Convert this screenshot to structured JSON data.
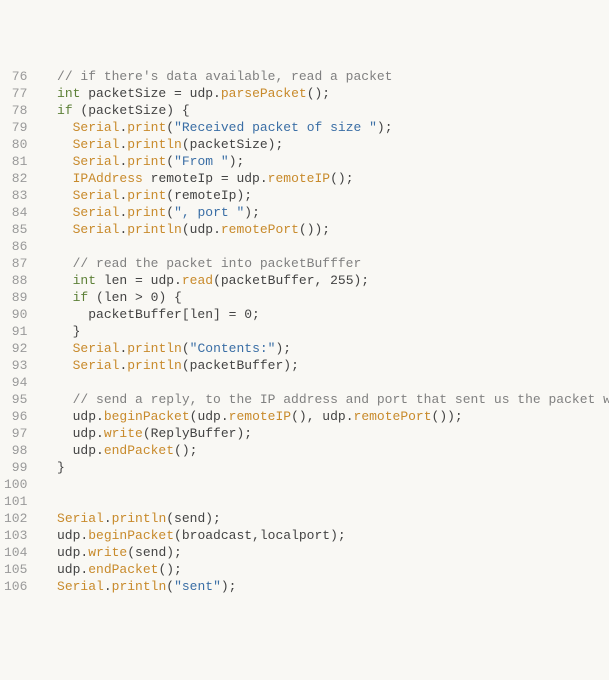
{
  "lines": [
    {
      "n": 76,
      "tokens": [
        {
          "t": "  ",
          "c": "pn"
        },
        {
          "t": "// if there's data available, read a packet",
          "c": "cm"
        }
      ]
    },
    {
      "n": 77,
      "tokens": [
        {
          "t": "  ",
          "c": "pn"
        },
        {
          "t": "int",
          "c": "ty"
        },
        {
          "t": " packetSize = udp.",
          "c": "id"
        },
        {
          "t": "parsePacket",
          "c": "fn"
        },
        {
          "t": "();",
          "c": "pn"
        }
      ]
    },
    {
      "n": 78,
      "tokens": [
        {
          "t": "  ",
          "c": "pn"
        },
        {
          "t": "if",
          "c": "kw"
        },
        {
          "t": " (packetSize) {",
          "c": "id"
        }
      ]
    },
    {
      "n": 79,
      "tokens": [
        {
          "t": "    ",
          "c": "pn"
        },
        {
          "t": "Serial",
          "c": "cl"
        },
        {
          "t": ".",
          "c": "pn"
        },
        {
          "t": "print",
          "c": "fn"
        },
        {
          "t": "(",
          "c": "pn"
        },
        {
          "t": "\"Received packet of size \"",
          "c": "st"
        },
        {
          "t": ");",
          "c": "pn"
        }
      ]
    },
    {
      "n": 80,
      "tokens": [
        {
          "t": "    ",
          "c": "pn"
        },
        {
          "t": "Serial",
          "c": "cl"
        },
        {
          "t": ".",
          "c": "pn"
        },
        {
          "t": "println",
          "c": "fn"
        },
        {
          "t": "(packetSize);",
          "c": "id"
        }
      ]
    },
    {
      "n": 81,
      "tokens": [
        {
          "t": "    ",
          "c": "pn"
        },
        {
          "t": "Serial",
          "c": "cl"
        },
        {
          "t": ".",
          "c": "pn"
        },
        {
          "t": "print",
          "c": "fn"
        },
        {
          "t": "(",
          "c": "pn"
        },
        {
          "t": "\"From \"",
          "c": "st"
        },
        {
          "t": ");",
          "c": "pn"
        }
      ]
    },
    {
      "n": 82,
      "tokens": [
        {
          "t": "    ",
          "c": "pn"
        },
        {
          "t": "IPAddress",
          "c": "cl"
        },
        {
          "t": " remoteIp = udp.",
          "c": "id"
        },
        {
          "t": "remoteIP",
          "c": "fn"
        },
        {
          "t": "();",
          "c": "pn"
        }
      ]
    },
    {
      "n": 83,
      "tokens": [
        {
          "t": "    ",
          "c": "pn"
        },
        {
          "t": "Serial",
          "c": "cl"
        },
        {
          "t": ".",
          "c": "pn"
        },
        {
          "t": "print",
          "c": "fn"
        },
        {
          "t": "(remoteIp);",
          "c": "id"
        }
      ]
    },
    {
      "n": 84,
      "tokens": [
        {
          "t": "    ",
          "c": "pn"
        },
        {
          "t": "Serial",
          "c": "cl"
        },
        {
          "t": ".",
          "c": "pn"
        },
        {
          "t": "print",
          "c": "fn"
        },
        {
          "t": "(",
          "c": "pn"
        },
        {
          "t": "\", port \"",
          "c": "st"
        },
        {
          "t": ");",
          "c": "pn"
        }
      ]
    },
    {
      "n": 85,
      "tokens": [
        {
          "t": "    ",
          "c": "pn"
        },
        {
          "t": "Serial",
          "c": "cl"
        },
        {
          "t": ".",
          "c": "pn"
        },
        {
          "t": "println",
          "c": "fn"
        },
        {
          "t": "(udp.",
          "c": "id"
        },
        {
          "t": "remotePort",
          "c": "fn"
        },
        {
          "t": "());",
          "c": "pn"
        }
      ]
    },
    {
      "n": 86,
      "tokens": [
        {
          "t": " ",
          "c": "pn"
        }
      ]
    },
    {
      "n": 87,
      "tokens": [
        {
          "t": "    ",
          "c": "pn"
        },
        {
          "t": "// read the packet into packetBufffer",
          "c": "cm"
        }
      ]
    },
    {
      "n": 88,
      "tokens": [
        {
          "t": "    ",
          "c": "pn"
        },
        {
          "t": "int",
          "c": "ty"
        },
        {
          "t": " len = udp.",
          "c": "id"
        },
        {
          "t": "read",
          "c": "fn"
        },
        {
          "t": "(packetBuffer, 255);",
          "c": "id"
        }
      ]
    },
    {
      "n": 89,
      "tokens": [
        {
          "t": "    ",
          "c": "pn"
        },
        {
          "t": "if",
          "c": "kw"
        },
        {
          "t": " (len > 0) {",
          "c": "id"
        }
      ]
    },
    {
      "n": 90,
      "tokens": [
        {
          "t": "      packetBuffer[len] = 0;",
          "c": "id"
        }
      ]
    },
    {
      "n": 91,
      "tokens": [
        {
          "t": "    }",
          "c": "id"
        }
      ]
    },
    {
      "n": 92,
      "tokens": [
        {
          "t": "    ",
          "c": "pn"
        },
        {
          "t": "Serial",
          "c": "cl"
        },
        {
          "t": ".",
          "c": "pn"
        },
        {
          "t": "println",
          "c": "fn"
        },
        {
          "t": "(",
          "c": "pn"
        },
        {
          "t": "\"Contents:\"",
          "c": "st"
        },
        {
          "t": ");",
          "c": "pn"
        }
      ]
    },
    {
      "n": 93,
      "tokens": [
        {
          "t": "    ",
          "c": "pn"
        },
        {
          "t": "Serial",
          "c": "cl"
        },
        {
          "t": ".",
          "c": "pn"
        },
        {
          "t": "println",
          "c": "fn"
        },
        {
          "t": "(packetBuffer);",
          "c": "id"
        }
      ]
    },
    {
      "n": 94,
      "tokens": [
        {
          "t": " ",
          "c": "pn"
        }
      ]
    },
    {
      "n": 95,
      "tokens": [
        {
          "t": "    ",
          "c": "pn"
        },
        {
          "t": "// send a reply, to the IP address and port that sent us the packet we received",
          "c": "cm"
        }
      ]
    },
    {
      "n": 96,
      "tokens": [
        {
          "t": "    udp.",
          "c": "id"
        },
        {
          "t": "beginPacket",
          "c": "fn"
        },
        {
          "t": "(udp.",
          "c": "id"
        },
        {
          "t": "remoteIP",
          "c": "fn"
        },
        {
          "t": "(), udp.",
          "c": "id"
        },
        {
          "t": "remotePort",
          "c": "fn"
        },
        {
          "t": "());",
          "c": "pn"
        }
      ]
    },
    {
      "n": 97,
      "tokens": [
        {
          "t": "    udp.",
          "c": "id"
        },
        {
          "t": "write",
          "c": "fn"
        },
        {
          "t": "(ReplyBuffer);",
          "c": "id"
        }
      ]
    },
    {
      "n": 98,
      "tokens": [
        {
          "t": "    udp.",
          "c": "id"
        },
        {
          "t": "endPacket",
          "c": "fn"
        },
        {
          "t": "();",
          "c": "pn"
        }
      ]
    },
    {
      "n": 99,
      "tokens": [
        {
          "t": "  }",
          "c": "id"
        }
      ]
    },
    {
      "n": 100,
      "tokens": [
        {
          "t": " ",
          "c": "pn"
        }
      ]
    },
    {
      "n": 101,
      "tokens": [
        {
          "t": " ",
          "c": "pn"
        }
      ]
    },
    {
      "n": 102,
      "tokens": [
        {
          "t": "  ",
          "c": "pn"
        },
        {
          "t": "Serial",
          "c": "cl"
        },
        {
          "t": ".",
          "c": "pn"
        },
        {
          "t": "println",
          "c": "fn"
        },
        {
          "t": "(send);",
          "c": "id"
        }
      ]
    },
    {
      "n": 103,
      "tokens": [
        {
          "t": "  udp.",
          "c": "id"
        },
        {
          "t": "beginPacket",
          "c": "fn"
        },
        {
          "t": "(broadcast,localport);",
          "c": "id"
        }
      ]
    },
    {
      "n": 104,
      "tokens": [
        {
          "t": "  udp.",
          "c": "id"
        },
        {
          "t": "write",
          "c": "fn"
        },
        {
          "t": "(send);",
          "c": "id"
        }
      ]
    },
    {
      "n": 105,
      "tokens": [
        {
          "t": "  udp.",
          "c": "id"
        },
        {
          "t": "endPacket",
          "c": "fn"
        },
        {
          "t": "();",
          "c": "pn"
        }
      ]
    },
    {
      "n": 106,
      "tokens": [
        {
          "t": "  ",
          "c": "pn"
        },
        {
          "t": "Serial",
          "c": "cl"
        },
        {
          "t": ".",
          "c": "pn"
        },
        {
          "t": "println",
          "c": "fn"
        },
        {
          "t": "(",
          "c": "pn"
        },
        {
          "t": "\"sent\"",
          "c": "st"
        },
        {
          "t": ");",
          "c": "pn"
        }
      ]
    }
  ]
}
